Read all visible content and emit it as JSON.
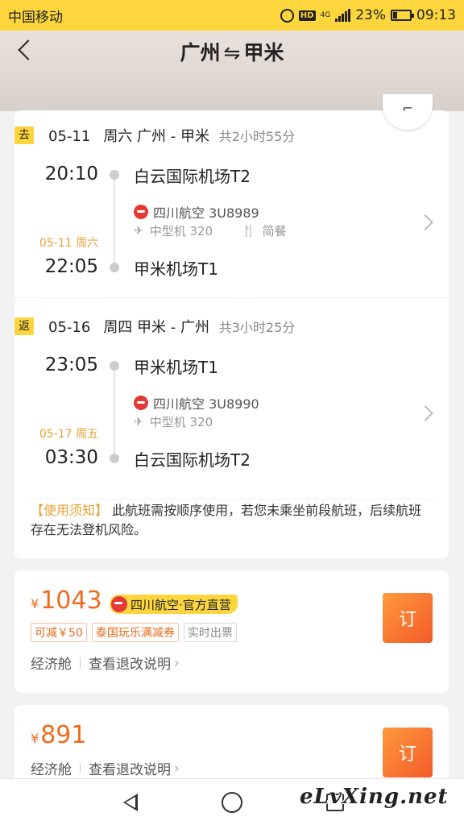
{
  "status_bar": {
    "carrier": "中国移动",
    "hd": "HD",
    "network": "4G",
    "battery": "23%",
    "time": "09:13"
  },
  "header": {
    "origin": "广州",
    "swap": "⇋",
    "destination": "甲米"
  },
  "floating_button": "⌐",
  "outbound": {
    "tag": "去",
    "date": "05-11",
    "weekday": "周六",
    "route": "广州 - 甲米",
    "duration": "共2小时55分",
    "dep_time": "20:10",
    "dep_airport": "白云国际机场T2",
    "airline": "四川航空 3U8989",
    "aircraft": "中型机 320",
    "meal": "简餐",
    "arr_date": "05-11 周六",
    "arr_time": "22:05",
    "arr_airport": "甲米机场T1"
  },
  "return": {
    "tag": "返",
    "date": "05-16",
    "weekday": "周四",
    "route": "甲米 - 广州",
    "duration": "共3小时25分",
    "dep_time": "23:05",
    "dep_airport": "甲米机场T1",
    "airline": "四川航空 3U8990",
    "aircraft": "中型机 320",
    "arr_date": "05-17 周五",
    "arr_time": "03:30",
    "arr_airport": "白云国际机场T2"
  },
  "notice": {
    "title": "【使用须知】",
    "text": "此航班需按顺序使用，若您未乘坐前段航班，后续航班存在无法登机风险。"
  },
  "offers": [
    {
      "currency": "¥",
      "price": "1043",
      "badge": "四川航空·官方直营",
      "tags": [
        "可减￥50",
        "泰国玩乐满减券",
        "实时出票"
      ],
      "cabin": "经济舱",
      "refund_link": "查看退改说明",
      "book_label": "订"
    },
    {
      "currency": "¥",
      "price": "891",
      "cabin": "经济舱",
      "refund_link": "查看退改说明",
      "book_label": "订"
    }
  ],
  "watermark": "eLvXing.net",
  "colors": {
    "brand_yellow": "#fcd63c",
    "price_orange": "#f26a1b",
    "accent_amber": "#e8a033"
  }
}
